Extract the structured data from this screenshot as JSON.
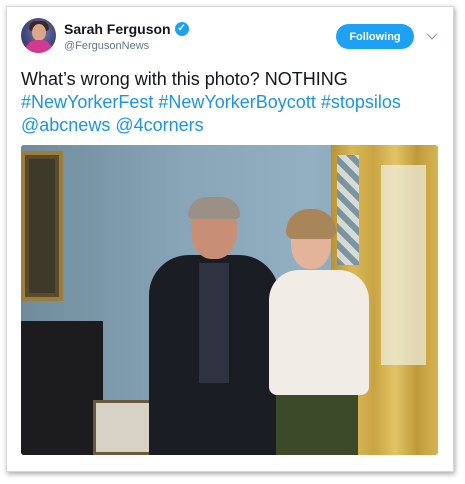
{
  "author": {
    "name": "Sarah Ferguson",
    "handle": "@FergusonNews",
    "verified_glyph": "✓"
  },
  "follow_button": {
    "label": "Following"
  },
  "tweet": {
    "segments": [
      {
        "text": "What’s wrong with this photo? NOTHING ",
        "type": "text"
      },
      {
        "text": "#NewYorkerFest",
        "type": "tag"
      },
      {
        "text": " ",
        "type": "text"
      },
      {
        "text": "#NewYorkerBoycott",
        "type": "tag"
      },
      {
        "text": " ",
        "type": "text"
      },
      {
        "text": "#stopsilos",
        "type": "tag"
      },
      {
        "text": " ",
        "type": "text"
      },
      {
        "text": "@abcnews",
        "type": "tag"
      },
      {
        "text": " ",
        "type": "text"
      },
      {
        "text": "@4corners",
        "type": "tag"
      }
    ]
  },
  "colors": {
    "accent": "#1da1f2",
    "link": "#1b95e0",
    "text": "#14171a",
    "muted": "#657786"
  },
  "icons": {
    "verified": "verified-badge-icon",
    "more": "chevron-down-icon"
  }
}
